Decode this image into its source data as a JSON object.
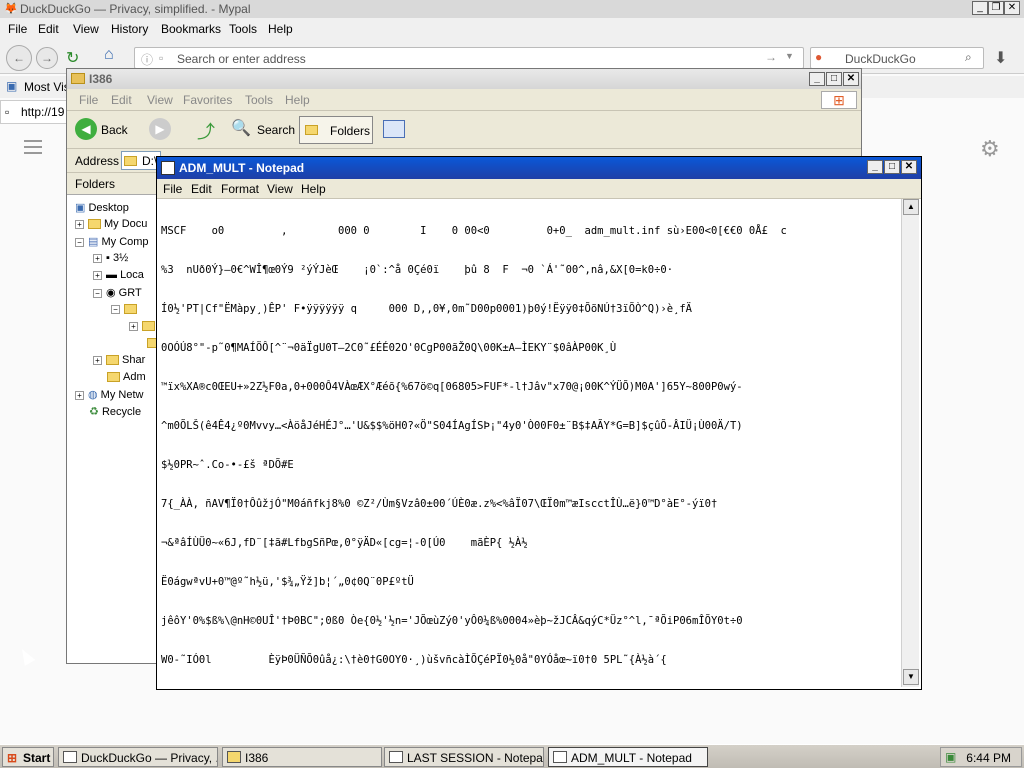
{
  "browser": {
    "title": "DuckDuckGo — Privacy, simplified. - Mypal",
    "menu": [
      "File",
      "Edit",
      "View",
      "History",
      "Bookmarks",
      "Tools",
      "Help"
    ],
    "url_placeholder": "Search or enter address",
    "search_engine": "DuckDuckGo",
    "bookmark": "Most Visi",
    "tab_url": "http://19"
  },
  "explorer": {
    "title": "I386",
    "menu": [
      "File",
      "Edit",
      "View",
      "Favorites",
      "Tools",
      "Help"
    ],
    "back_label": "Back",
    "search_label": "Search",
    "folders_label": "Folders",
    "address_label": "Address",
    "address_value": "D:\\",
    "folders_header": "Folders",
    "tree": [
      {
        "label": "Desktop",
        "exp": ""
      },
      {
        "label": "My Docu",
        "exp": "+"
      },
      {
        "label": "My Comp",
        "exp": "-"
      },
      {
        "label": "3½",
        "exp": "+"
      },
      {
        "label": "Loca",
        "exp": "+"
      },
      {
        "label": "GRT",
        "exp": "-"
      },
      {
        "label": "",
        "exp": "-"
      },
      {
        "label": "",
        "exp": "+"
      },
      {
        "label": "",
        "exp": ""
      },
      {
        "label": "Shar",
        "exp": "+"
      },
      {
        "label": "Adm",
        "exp": ""
      },
      {
        "label": "My Netw",
        "exp": "+"
      },
      {
        "label": "Recycle",
        "exp": ""
      }
    ]
  },
  "notepad": {
    "title": "ADM_MULT - Notepad",
    "menu": [
      "File",
      "Edit",
      "Format",
      "View",
      "Help"
    ],
    "lines": [
      "MSCF    o0         ,        000 0        I    0 00<0         0+0_  adm_mult.inf sù›E00<0[€€0 0Å£  c",
      "%3  nUð0Ý}—0€^WÎ¶œ0Ý9 ²ýÝJèŒ    ¡0`:^å 0Çé0ï    þû 8  F  ¬0 `Á'˜00^,nâ,&X[0=k0÷0·",
      "Í0½'PT|Cf\"ËMàpy¸)ÊP' F•ÿÿÿÿÿÿ q     000 D,,0¥,0m˜D00p0001)þ0ý!Ëÿÿ0‡ÕõNÚ†3ïÕÒ^Q)›è¸fÄ",
      "0OÓÚ8°\"-p˜0¶MAÍÖÔ[^¨¬0äÏgU0T–2C0˜£ÉÉ02O'0CgP00ãŽ0Q\\00K±A–ÌEKY¨$0âÀP00K¸Ù",
      "™ïx%XA®c0ŒEU+»2Z½F0a,0+000Ô4VÀœÆX°Æéõ{%67ö©q[06805>FUF*-l†Jâv\"x70@¡00K^ÝÜÕ)M0A']65Y~800P0wý-",
      "^m0ÕLŠ(ê4Ê4¿º0Mvvy…<ÀöåJéHÉJ°…'U&$$%öH0?«Ö\"S04ÍAgÍSÞ¡\"4y0'Ò00F0±¨B$‡AÃY*G=B]$çûÕ-ÂIÜ¡Ù00Ä/T)",
      "$½0PR~ˆ.Co-•-£š ªDÕ#E",
      "7{_ÀÀ, ñAV¶Ï0†ÔûžjÓ\"M0áñfkj8%0 ©Z²/Ùm§Vzâ0±00´ÚÈ0æ.z%<%âÏ07\\ŒÏ0m™æIscctÎÙ…ë}0™D°àE°-ýï0†",
      "¬&ªâÍÙÜ0~«6J,fD¨[‡ã#LfbgSñPœ,0°ÿÄD«[cg=¦-0[Ú0    mãÈP{ ½À½",
      "Ë0ágwªvU+0™@º˜h½ü,'$¾„Ÿž]b¦´„0¢0Q¨0P£ºtÜ",
      "jêôY'0%$ß%\\@nH©0UÎ'†Þ0BC\";0ß0 Òe{0½'½n='JÕœùZý0'yÔ0¼ß%0004»èþ~žJCÂ&qýC*Üz°^l,¯ªÕiP06mÎÕY0t÷0",
      "W0-˜IÓ0l         ÈÿÞ0ÜÑÕ0ûå¿:\\†è0†G0OY0·¸)ùšvñcàÌÕÇéPÏ0½0å\"0YÓåœ~ï0†0 5PL˜{À½à´{"
    ]
  },
  "taskbar": {
    "start": "Start",
    "buttons": [
      {
        "label": "DuckDuckGo — Privacy, ..."
      },
      {
        "label": "I386"
      },
      {
        "label": "LAST SESSION - Notepad"
      },
      {
        "label": "ADM_MULT - Notepad"
      }
    ],
    "clock": "6:44 PM"
  }
}
